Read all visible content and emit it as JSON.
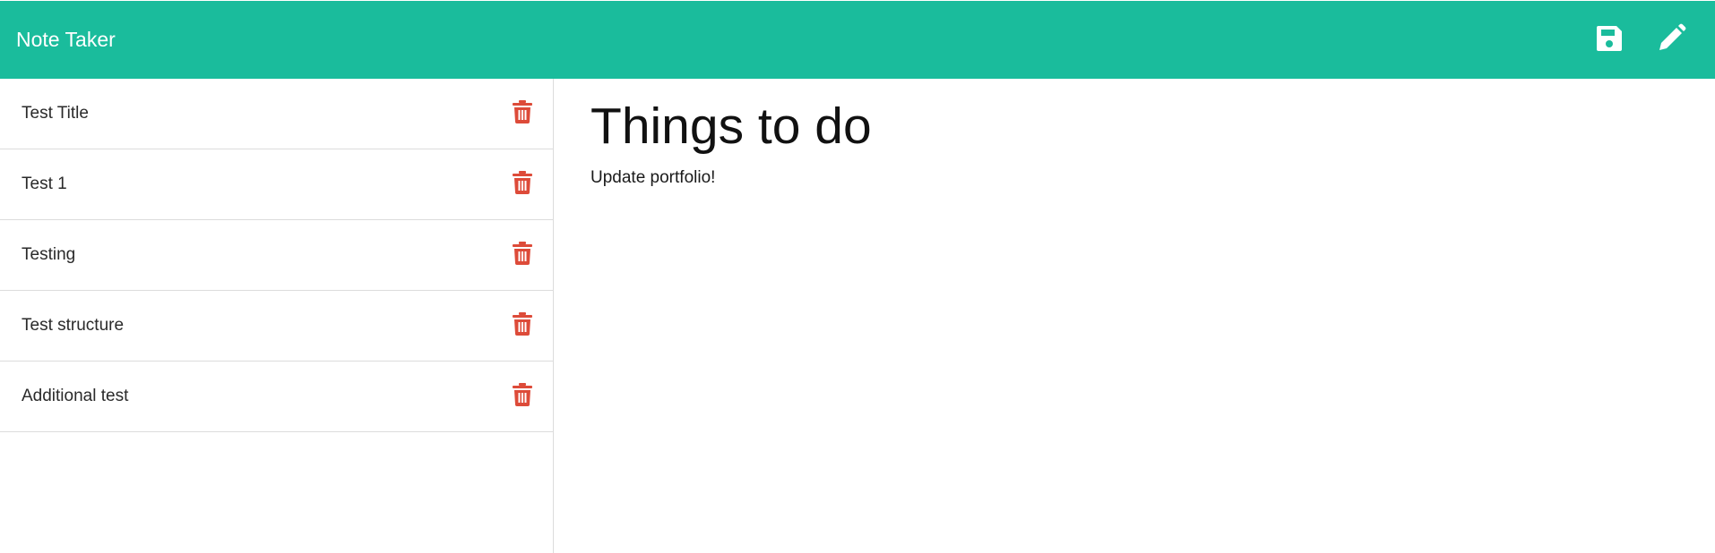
{
  "app": {
    "title": "Note Taker"
  },
  "toolbar": {
    "save_icon": "save-icon",
    "new_icon": "pencil-icon"
  },
  "colors": {
    "navbar": "#1abc9c",
    "delete": "#dd4b39",
    "icon": "#ffffff"
  },
  "notes": [
    {
      "title": "Test Title"
    },
    {
      "title": "Test 1"
    },
    {
      "title": "Testing"
    },
    {
      "title": "Test structure"
    },
    {
      "title": "Additional test"
    }
  ],
  "editor": {
    "title": "Things to do",
    "text": "Update portfolio!"
  }
}
